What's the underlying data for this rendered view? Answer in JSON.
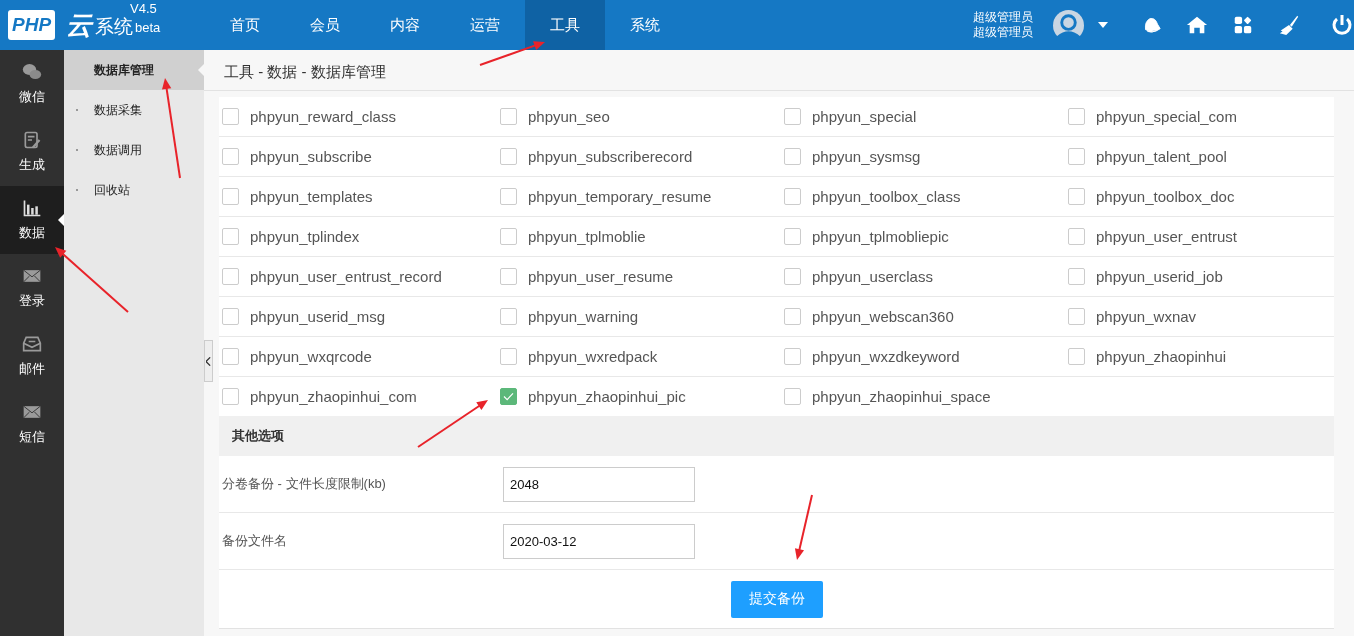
{
  "logo": {
    "mark": "PHP",
    "name_cn": "云",
    "name": "系统",
    "version": "V4.5",
    "tag": "beta"
  },
  "top_nav": [
    {
      "label": "首页",
      "selected": false
    },
    {
      "label": "会员",
      "selected": false
    },
    {
      "label": "内容",
      "selected": false
    },
    {
      "label": "运营",
      "selected": false
    },
    {
      "label": "工具",
      "selected": true
    },
    {
      "label": "系统",
      "selected": false
    }
  ],
  "user": {
    "name": "超级管理员",
    "role": "超级管理员"
  },
  "side_nav": [
    {
      "label": "微信",
      "selected": false
    },
    {
      "label": "生成",
      "selected": false
    },
    {
      "label": "数据",
      "selected": true
    },
    {
      "label": "登录",
      "selected": false
    },
    {
      "label": "邮件",
      "selected": false
    },
    {
      "label": "短信",
      "selected": false
    }
  ],
  "sub_nav": [
    {
      "label": "数据库管理",
      "selected": true
    },
    {
      "label": "数据采集",
      "selected": false
    },
    {
      "label": "数据调用",
      "selected": false
    },
    {
      "label": "回收站",
      "selected": false
    }
  ],
  "breadcrumb": "工具 - 数据 - 数据库管理",
  "tables": [
    {
      "name": "phpyun_reward_class",
      "checked": false
    },
    {
      "name": "phpyun_seo",
      "checked": false
    },
    {
      "name": "phpyun_special",
      "checked": false
    },
    {
      "name": "phpyun_special_com",
      "checked": false
    },
    {
      "name": "phpyun_subscribe",
      "checked": false
    },
    {
      "name": "phpyun_subscriberecord",
      "checked": false
    },
    {
      "name": "phpyun_sysmsg",
      "checked": false
    },
    {
      "name": "phpyun_talent_pool",
      "checked": false
    },
    {
      "name": "phpyun_templates",
      "checked": false
    },
    {
      "name": "phpyun_temporary_resume",
      "checked": false
    },
    {
      "name": "phpyun_toolbox_class",
      "checked": false
    },
    {
      "name": "phpyun_toolbox_doc",
      "checked": false
    },
    {
      "name": "phpyun_tplindex",
      "checked": false
    },
    {
      "name": "phpyun_tplmoblie",
      "checked": false
    },
    {
      "name": "phpyun_tplmobliepic",
      "checked": false
    },
    {
      "name": "phpyun_user_entrust",
      "checked": false
    },
    {
      "name": "phpyun_user_entrust_record",
      "checked": false
    },
    {
      "name": "phpyun_user_resume",
      "checked": false
    },
    {
      "name": "phpyun_userclass",
      "checked": false
    },
    {
      "name": "phpyun_userid_job",
      "checked": false
    },
    {
      "name": "phpyun_userid_msg",
      "checked": false
    },
    {
      "name": "phpyun_warning",
      "checked": false
    },
    {
      "name": "phpyun_webscan360",
      "checked": false
    },
    {
      "name": "phpyun_wxnav",
      "checked": false
    },
    {
      "name": "phpyun_wxqrcode",
      "checked": false
    },
    {
      "name": "phpyun_wxredpack",
      "checked": false
    },
    {
      "name": "phpyun_wxzdkeyword",
      "checked": false
    },
    {
      "name": "phpyun_zhaopinhui",
      "checked": false
    },
    {
      "name": "phpyun_zhaopinhui_com",
      "checked": false
    },
    {
      "name": "phpyun_zhaopinhui_pic",
      "checked": true
    },
    {
      "name": "phpyun_zhaopinhui_space",
      "checked": false
    }
  ],
  "other_options": {
    "title": "其他选项",
    "fields": [
      {
        "label": "分卷备份 - 文件长度限制(kb)",
        "value": "2048"
      },
      {
        "label": "备份文件名",
        "value": "2020-03-12"
      }
    ]
  },
  "submit": "提交备份"
}
